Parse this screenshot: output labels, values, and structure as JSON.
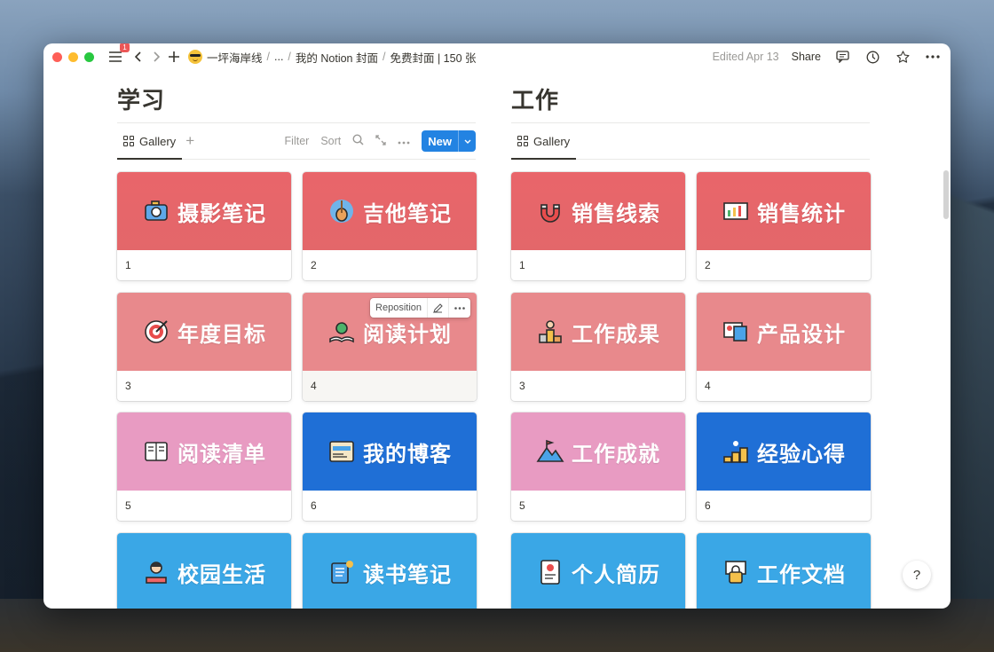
{
  "topbar": {
    "badge": "1",
    "crumbs": [
      "一坪海岸线",
      "...",
      "我的 Notion 封面",
      "免费封面 | 150 张"
    ],
    "edited": "Edited Apr 13",
    "share": "Share"
  },
  "columns": [
    {
      "title": "学习",
      "view_tab": "Gallery",
      "tools": {
        "filter": "Filter",
        "sort": "Sort",
        "new": "New"
      },
      "cards": [
        {
          "label": "摄影笔记",
          "num": "1",
          "color": "red",
          "icon": "camera-icon"
        },
        {
          "label": "吉他笔记",
          "num": "2",
          "color": "red",
          "icon": "guitar-icon"
        },
        {
          "label": "年度目标",
          "num": "3",
          "color": "salmon",
          "icon": "target-icon"
        },
        {
          "label": "阅读计划",
          "num": "4",
          "color": "salmon",
          "icon": "book-globe-icon"
        },
        {
          "label": "阅读清单",
          "num": "5",
          "color": "pink",
          "icon": "open-book-icon"
        },
        {
          "label": "我的博客",
          "num": "6",
          "color": "blue",
          "icon": "blog-icon"
        },
        {
          "label": "校园生活",
          "num": "",
          "color": "sky",
          "icon": "student-icon"
        },
        {
          "label": "读书笔记",
          "num": "",
          "color": "sky",
          "icon": "notebook-icon"
        }
      ]
    },
    {
      "title": "工作",
      "view_tab": "Gallery",
      "cards": [
        {
          "label": "销售线索",
          "num": "1",
          "color": "red",
          "icon": "magnet-icon"
        },
        {
          "label": "销售统计",
          "num": "2",
          "color": "red",
          "icon": "chart-board-icon"
        },
        {
          "label": "工作成果",
          "num": "3",
          "color": "salmon",
          "icon": "winner-icon"
        },
        {
          "label": "产品设计",
          "num": "4",
          "color": "salmon",
          "icon": "design-icon"
        },
        {
          "label": "工作成就",
          "num": "5",
          "color": "pink",
          "icon": "mountain-flag-icon"
        },
        {
          "label": "经验心得",
          "num": "6",
          "color": "blue",
          "icon": "steps-icon"
        },
        {
          "label": "个人简历",
          "num": "",
          "color": "sky",
          "icon": "resume-icon"
        },
        {
          "label": "工作文档",
          "num": "",
          "color": "sky",
          "icon": "lock-doc-icon"
        }
      ]
    }
  ],
  "hover_toolbar": {
    "reposition": "Reposition"
  },
  "help": "?",
  "colors": {
    "red": "#e5676b",
    "salmon": "#e8898c",
    "pink": "#e89bc2",
    "blue": "#1f6fd6",
    "sky": "#3aa7e6",
    "accent": "#2383e2"
  }
}
